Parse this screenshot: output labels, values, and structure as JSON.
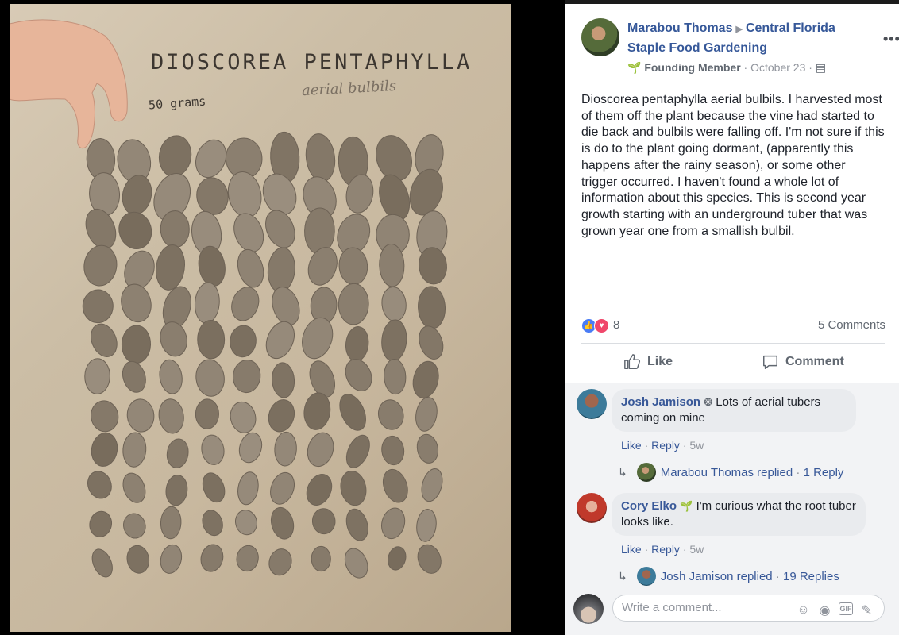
{
  "photo": {
    "handwriting_title": "DIOSCOREA PENTAPHYLLA",
    "handwriting_subtitle": "aerial bulbils",
    "handwriting_weight": "50 grams"
  },
  "post": {
    "author": "Marabou Thomas",
    "group": "Central Florida Staple Food Gardening",
    "badge": "Founding Member",
    "date": "October 23",
    "more_label": "•••",
    "text": "Dioscorea pentaphylla aerial bulbils. I harvested most of them off the plant because the vine had started to die back and bulbils were falling off. I'm not sure if this is do to the plant going dormant, (apparently this happens after the rainy season), or some other trigger occurred. I haven't found a whole lot of information about this species. This is second year growth starting with an underground tuber that was grown year one from a smallish bulbil.",
    "reaction_count": "8",
    "comment_count": "5 Comments",
    "like_label": "Like",
    "comment_label": "Comment",
    "colors": {
      "link": "#365899",
      "like": "#4a7cf5",
      "love": "#f0476b"
    }
  },
  "comments": [
    {
      "name": "Josh Jamison",
      "text": "Lots of aerial tubers coming on mine",
      "badge_icon": "shield-badge-icon",
      "like": "Like",
      "reply": "Reply",
      "time": "5w",
      "replies_by": "Marabou Thomas replied",
      "replies_count": "1 Reply"
    },
    {
      "name": "Cory Elko",
      "text": "I'm curious what the root tuber looks like.",
      "badge_icon": "sprout-badge-icon",
      "like": "Like",
      "reply": "Reply",
      "time": "5w",
      "replies_by": "Josh Jamison replied",
      "replies_count": "19 Replies"
    }
  ],
  "composer": {
    "placeholder": "Write a comment...",
    "icons": [
      "emoji-icon",
      "camera-icon",
      "gif-icon",
      "sticker-icon"
    ]
  }
}
